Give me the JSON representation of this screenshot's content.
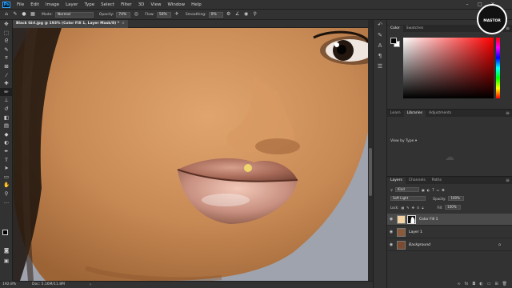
{
  "menubar": {
    "logo": "Ps",
    "items": [
      "File",
      "Edit",
      "Image",
      "Layer",
      "Type",
      "Select",
      "Filter",
      "3D",
      "View",
      "Window",
      "Help"
    ],
    "window_controls": [
      "–",
      "□",
      "✕"
    ]
  },
  "options": {
    "mode_label": "Mode:",
    "mode_value": "Normal",
    "opacity_label": "Opacity:",
    "opacity_value": "74%",
    "flow_label": "Flow:",
    "flow_value": "56%",
    "smoothing_label": "Smoothing:",
    "smoothing_value": "0%"
  },
  "document": {
    "tab_title": "Black Girl.jpg @ 193% (Color Fill 1, Layer Mask/8) *",
    "close_glyph": "×"
  },
  "status": {
    "zoom": "192.8%",
    "doc_size": "Doc: 5.16M/11.8M"
  },
  "tools": [
    "move-icon",
    "marquee-icon",
    "lasso-icon",
    "quick-select-icon",
    "crop-icon",
    "frame-icon",
    "eyedropper-icon",
    "healing-icon",
    "brush-icon",
    "clone-stamp-icon",
    "history-brush-icon",
    "eraser-icon",
    "gradient-icon",
    "blur-icon",
    "dodge-icon",
    "pen-icon",
    "type-icon",
    "path-select-icon",
    "rectangle-icon",
    "hand-icon",
    "zoom-icon",
    "more-tools-icon"
  ],
  "panels": {
    "color_tabs": [
      "Color",
      "Swatches"
    ],
    "library_tabs": [
      "Learn",
      "Libraries",
      "Adjustments"
    ],
    "view_by": "View by Type ▾",
    "layers_tabs": [
      "Layers",
      "Channels",
      "Paths"
    ],
    "filter_kind": "Kind",
    "blend_mode": "Soft Light",
    "opacity_label": "Opacity:",
    "opacity_value": "100%",
    "lock_label": "Lock:",
    "fill_label": "Fill:",
    "fill_value": "100%"
  },
  "layers": [
    {
      "name": "Color Fill 1",
      "selected": true,
      "thumb_color": "#f3d3a4"
    },
    {
      "name": "Layer 1",
      "selected": false,
      "thumb_color": "#8a5a3a"
    },
    {
      "name": "Background",
      "selected": false,
      "thumb_color": "#7a4b30",
      "locked": true
    }
  ],
  "watermark": {
    "text": "MASTOR"
  },
  "colors": {
    "chrome_dark": "#282828",
    "chrome": "#323232",
    "skin": "#c88a55",
    "background_gray": "#9ea3ae"
  }
}
